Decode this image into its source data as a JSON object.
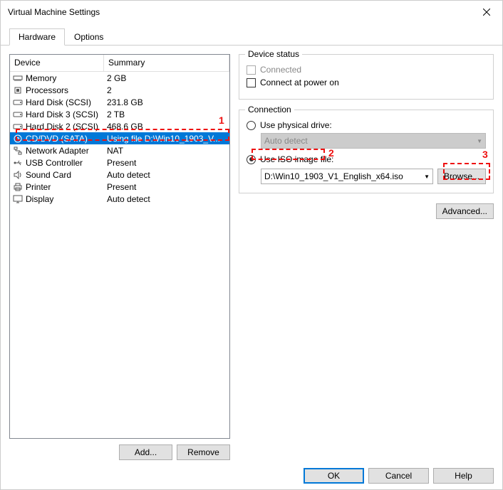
{
  "window": {
    "title": "Virtual Machine Settings"
  },
  "tabs": {
    "hardware": "Hardware",
    "options": "Options"
  },
  "table": {
    "col_device": "Device",
    "col_summary": "Summary",
    "rows": [
      {
        "device": "Memory",
        "summary": "2 GB"
      },
      {
        "device": "Processors",
        "summary": "2"
      },
      {
        "device": "Hard Disk (SCSI)",
        "summary": "231.8 GB"
      },
      {
        "device": "Hard Disk 3 (SCSI)",
        "summary": "2 TB"
      },
      {
        "device": "Hard Disk 2 (SCSI)",
        "summary": "468.6 GB"
      },
      {
        "device": "CD/DVD (SATA)",
        "summary": "Using file D:\\Win10_1903_V..."
      },
      {
        "device": "Network Adapter",
        "summary": "NAT"
      },
      {
        "device": "USB Controller",
        "summary": "Present"
      },
      {
        "device": "Sound Card",
        "summary": "Auto detect"
      },
      {
        "device": "Printer",
        "summary": "Present"
      },
      {
        "device": "Display",
        "summary": "Auto detect"
      }
    ]
  },
  "left_buttons": {
    "add": "Add...",
    "remove": "Remove"
  },
  "status": {
    "legend": "Device status",
    "connected": "Connected",
    "power_on": "Connect at power on"
  },
  "connection": {
    "legend": "Connection",
    "physical": "Use physical drive:",
    "physical_value": "Auto detect",
    "iso": "Use ISO image file:",
    "iso_value": "D:\\Win10_1903_V1_English_x64.iso",
    "browse": "Browse..."
  },
  "advanced": "Advanced...",
  "bottom": {
    "ok": "OK",
    "cancel": "Cancel",
    "help": "Help"
  },
  "anno": {
    "n1": "1",
    "n2": "2",
    "n3": "3"
  }
}
